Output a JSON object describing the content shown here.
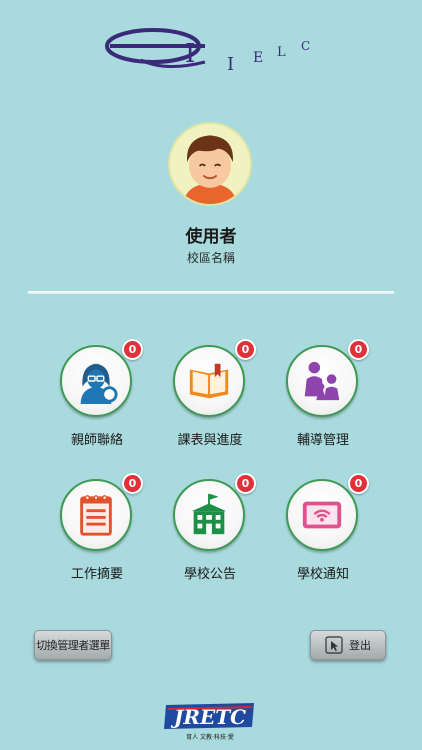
{
  "app": {
    "logo_text": "IELC",
    "footer_brand": "JRETC",
    "footer_tagline": "育人 文教·科技·愛"
  },
  "profile": {
    "user_name": "使用者",
    "school_name": "校區名稱"
  },
  "menu": [
    {
      "label": "親師聯絡",
      "badge": "0",
      "icon": "teacher-icon"
    },
    {
      "label": "課表與進度",
      "badge": "0",
      "icon": "book-icon"
    },
    {
      "label": "輔導管理",
      "badge": "0",
      "icon": "family-icon"
    },
    {
      "label": "工作摘要",
      "badge": "0",
      "icon": "notepad-icon"
    },
    {
      "label": "學校公告",
      "badge": "0",
      "icon": "school-icon"
    },
    {
      "label": "學校通知",
      "badge": "0",
      "icon": "tablet-wifi-icon"
    }
  ],
  "buttons": {
    "admin_menu": "切換管理者選單",
    "logout": "登出"
  },
  "colors": {
    "background": "#a9dade",
    "badge": "#e0313a",
    "tile_ring": "#3f9a56"
  }
}
